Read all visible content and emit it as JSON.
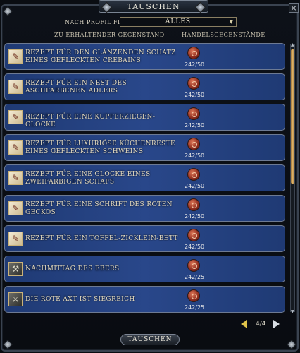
{
  "window": {
    "title": "Tauschen",
    "close_glyph": "×"
  },
  "filter": {
    "label": "Nach Profil filtern",
    "value": "Alles",
    "arrow": "▼"
  },
  "columns": {
    "left": "Zu erhaltender Gegenstand",
    "right": "Handelsgegenstände"
  },
  "rows": [
    {
      "label": "Rezept für den glänzenden Schatz eines gefleckten Crebains",
      "icon": "recipe-scroll-icon",
      "glyph": "✎",
      "count": "242/50"
    },
    {
      "label": "Rezept für ein Nest des aschfarbenen Adlers",
      "icon": "recipe-scroll-icon",
      "glyph": "✎",
      "count": "242/50"
    },
    {
      "label": "Rezept für eine Kupferziegen-Glocke",
      "icon": "recipe-scroll-icon",
      "glyph": "✎",
      "count": "242/50"
    },
    {
      "label": "Rezept für luxuriöse Küchenreste eines gefleckten Schweins",
      "icon": "recipe-scroll-icon",
      "glyph": "✎",
      "count": "242/50"
    },
    {
      "label": "Rezept für eine Glocke eines zweifarbigen Schafs",
      "icon": "recipe-scroll-icon",
      "glyph": "✎",
      "count": "242/50"
    },
    {
      "label": "Rezept für eine Schrift des roten Geckos",
      "icon": "recipe-scroll-icon",
      "glyph": "✎",
      "count": "242/50"
    },
    {
      "label": "Rezept für ein Toffel-Zicklein-Bett",
      "icon": "recipe-scroll-icon",
      "glyph": "✎",
      "count": "242/50"
    },
    {
      "label": "Nachmittag des Ebers",
      "icon": "tool-icon",
      "glyph": "⚒",
      "count": "242/25"
    },
    {
      "label": "Die Rote Axt ist siegreich",
      "icon": "axe-icon",
      "glyph": "⚔",
      "count": "242/25"
    }
  ],
  "pager": {
    "text": "4/4"
  },
  "trade_button": {
    "label": "Tauschen"
  },
  "scroll": {
    "up_glyph": "▲",
    "down_glyph": "▼",
    "position": 0.0
  },
  "colors": {
    "row_bg": "#29478a",
    "label_text": "#e2d9c0",
    "accent_gold": "#e0c44a",
    "currency": "#8b2a1c"
  }
}
